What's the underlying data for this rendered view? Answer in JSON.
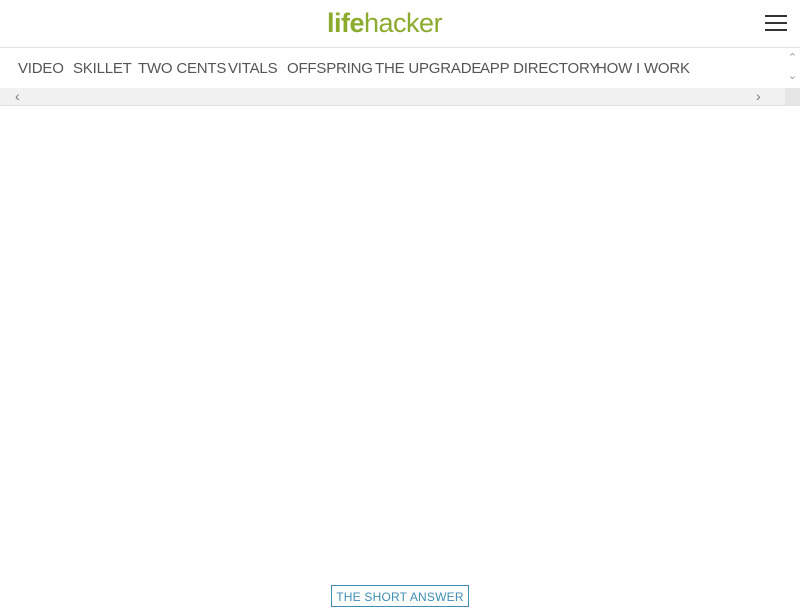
{
  "header": {
    "logo_part1": "life",
    "logo_part2": "hacker",
    "menu_icon": "hamburger-menu-icon"
  },
  "nav": {
    "items": [
      {
        "label": "VIDEO"
      },
      {
        "label": "SKILLET"
      },
      {
        "label": "TWO CENTS"
      },
      {
        "label": "VITALS"
      },
      {
        "label": "OFFSPRING"
      },
      {
        "label": "THE UPGRADE"
      },
      {
        "label": "APP DIRECTORY"
      },
      {
        "label": "HOW I WORK"
      }
    ],
    "scroll_left_icon": "chevron-left-icon",
    "scroll_right_icon": "chevron-right-icon"
  },
  "article": {
    "tag_label": "THE SHORT ANSWER"
  },
  "colors": {
    "brand": "#8aab2c",
    "tag": "#3d8fb5",
    "nav_text": "#555555"
  }
}
